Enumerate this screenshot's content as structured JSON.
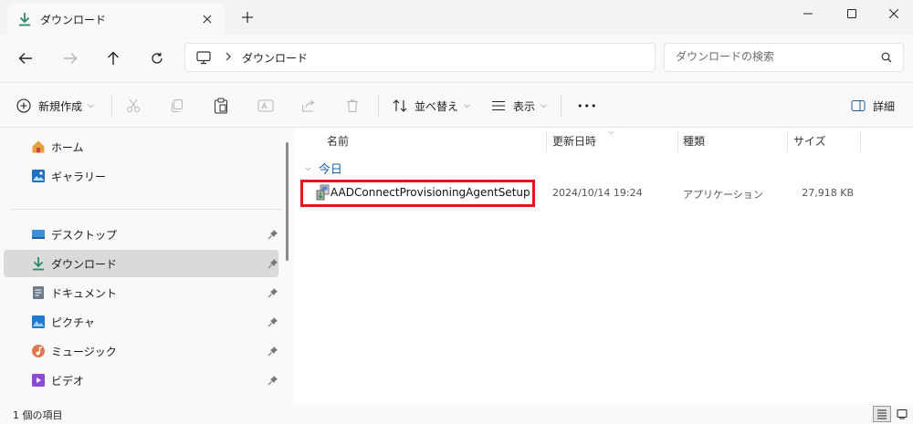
{
  "window": {
    "tab_title": "ダウンロード",
    "accent": "#2a8a6a",
    "highlight_color": "#e8151a"
  },
  "address": {
    "crumb": "ダウンロード"
  },
  "search": {
    "placeholder": "ダウンロードの検索"
  },
  "toolbar": {
    "new_label": "新規作成",
    "sort_label": "並べ替え",
    "view_label": "表示",
    "more_label": "•••",
    "details_label": "詳細"
  },
  "sidebar": {
    "items": [
      {
        "label": "ホーム",
        "icon": "home-icon"
      },
      {
        "label": "ギャラリー",
        "icon": "gallery-icon"
      },
      {
        "label": "デスクトップ",
        "icon": "desktop-icon",
        "pinned": true
      },
      {
        "label": "ダウンロード",
        "icon": "download-icon",
        "pinned": true,
        "selected": true
      },
      {
        "label": "ドキュメント",
        "icon": "document-icon",
        "pinned": true
      },
      {
        "label": "ピクチャ",
        "icon": "picture-icon",
        "pinned": true
      },
      {
        "label": "ミュージック",
        "icon": "music-icon",
        "pinned": true
      },
      {
        "label": "ビデオ",
        "icon": "video-icon",
        "pinned": true
      }
    ]
  },
  "columns": {
    "name": "名前",
    "date": "更新日時",
    "type": "種類",
    "size": "サイズ"
  },
  "group": {
    "label": "今日"
  },
  "files": [
    {
      "name": "AADConnectProvisioningAgentSetup",
      "date": "2024/10/14 19:24",
      "type": "アプリケーション",
      "size": "27,918 KB"
    }
  ],
  "status": {
    "count": "1 個の項目"
  }
}
